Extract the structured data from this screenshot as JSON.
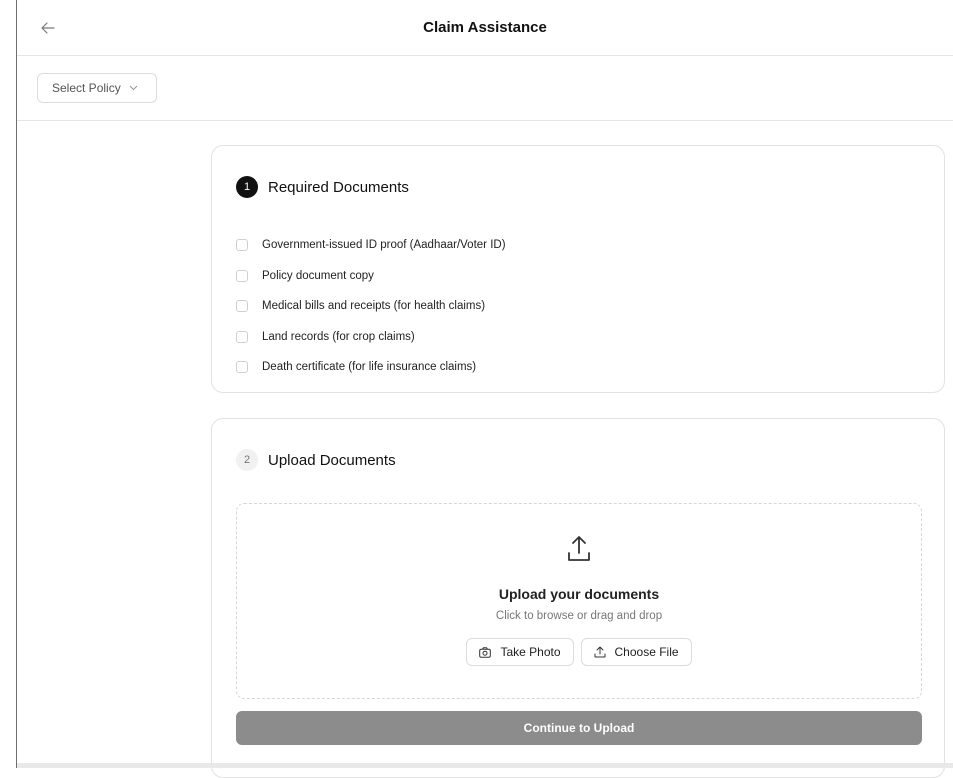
{
  "header": {
    "title": "Claim Assistance"
  },
  "policy_select": {
    "value": "Select Policy"
  },
  "step1": {
    "number": "1",
    "title": "Required Documents",
    "documents": [
      "Government-issued ID proof (Aadhaar/Voter ID)",
      "Policy document copy",
      "Medical bills and receipts (for health claims)",
      "Land records (for crop claims)",
      "Death certificate (for life insurance claims)"
    ]
  },
  "step2": {
    "number": "2",
    "title": "Upload Documents",
    "dropzone": {
      "title": "Upload your documents",
      "subtitle": "Click to browse or drag and drop"
    },
    "take_photo_label": "Take Photo",
    "choose_file_label": "Choose File",
    "continue_label": "Continue to Upload"
  },
  "icons": {
    "back": "arrow-left-icon",
    "dropdown": "chevron-down-icon",
    "upload": "upload-icon",
    "camera": "camera-icon",
    "choose_file": "upload-small-icon"
  },
  "colors": {
    "active_step": "#111111",
    "continue_disabled": "#8c8c8c"
  }
}
